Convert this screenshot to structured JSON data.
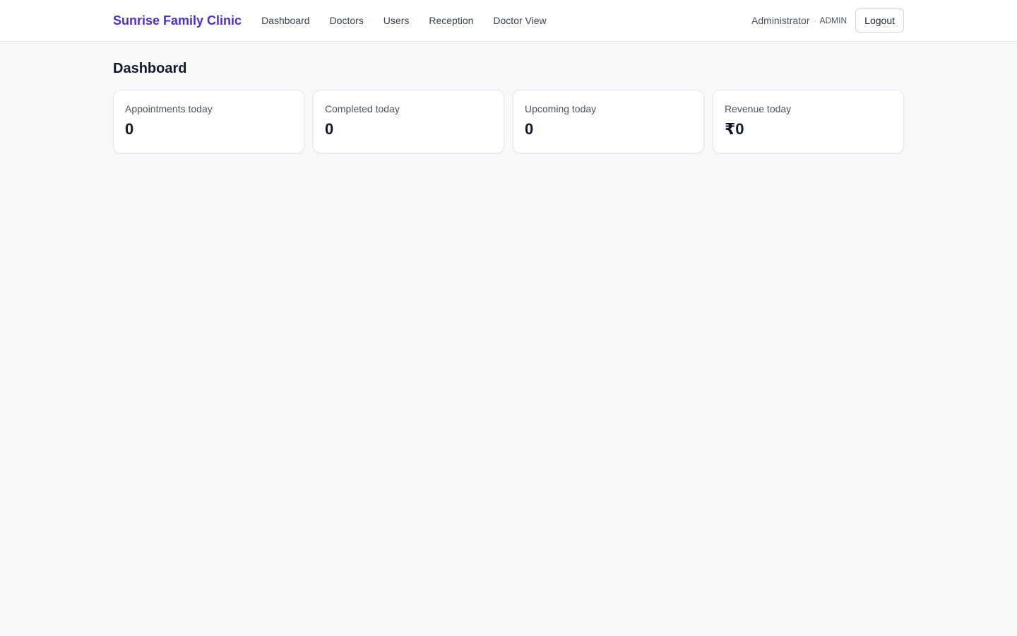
{
  "header": {
    "brand": "Sunrise Family Clinic",
    "nav": [
      {
        "label": "Dashboard"
      },
      {
        "label": "Doctors"
      },
      {
        "label": "Users"
      },
      {
        "label": "Reception"
      },
      {
        "label": "Doctor View"
      }
    ],
    "user": {
      "name": "Administrator",
      "separator": "·",
      "role": "ADMIN"
    },
    "logout_label": "Logout"
  },
  "main": {
    "title": "Dashboard",
    "stats": [
      {
        "label": "Appointments today",
        "value": "0"
      },
      {
        "label": "Completed today",
        "value": "0"
      },
      {
        "label": "Upcoming today",
        "value": "0"
      },
      {
        "label": "Revenue today",
        "value": "₹0"
      }
    ]
  },
  "colors": {
    "brand": "#4f2fd0",
    "background": "#f8f9fb",
    "card": "#ffffff"
  }
}
